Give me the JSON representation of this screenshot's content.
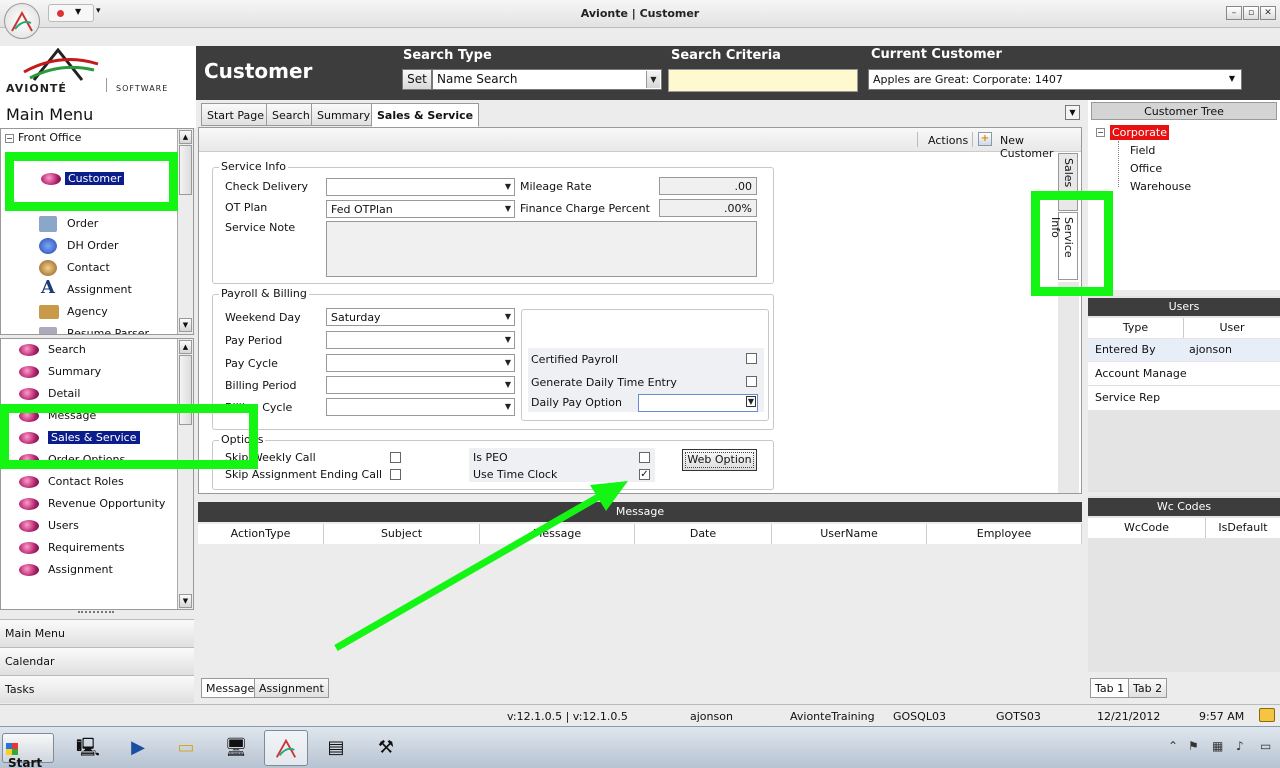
{
  "window": {
    "title": "Avionte | Customer"
  },
  "logo": {
    "brand": "AVIONTÉ",
    "software": "SOFTWARE"
  },
  "header": {
    "page_title": "Customer",
    "search_type_label": "Search Type",
    "set_label": "Set",
    "search_type_value": "Name Search",
    "search_criteria_label": "Search Criteria",
    "search_criteria_value": "",
    "current_customer_label": "Current Customer",
    "current_customer_value": "Apples are Great: Corporate: 1407"
  },
  "main_menu": {
    "title": "Main Menu",
    "tree_root": "Front Office",
    "tree_items": [
      {
        "label": "Customer",
        "icon": "customer-icon",
        "selected": true
      },
      {
        "label": "Order",
        "icon": "order-icon"
      },
      {
        "label": "DH Order",
        "icon": "dh-order-icon"
      },
      {
        "label": "Contact",
        "icon": "contact-icon"
      },
      {
        "label": "Assignment",
        "icon": "assignment-icon"
      },
      {
        "label": "Agency",
        "icon": "agency-icon"
      },
      {
        "label": "Resume Parser",
        "icon": "resume-parser-icon"
      }
    ],
    "sub_items": [
      "Search",
      "Summary",
      "Detail",
      "Message",
      "Sales & Service",
      "Order Options",
      "Contact Roles",
      "Revenue Opportunity",
      "Users",
      "Requirements",
      "Assignment"
    ],
    "selected_sub_item": "Sales & Service",
    "nav_buttons": [
      "Main Menu",
      "Calendar",
      "Tasks"
    ]
  },
  "tabs": [
    "Start Page",
    "Search",
    "Summary",
    "Sales & Service"
  ],
  "active_tab": "Sales & Service",
  "actions": {
    "actions_label": "Actions",
    "new_customer_label": "New Customer"
  },
  "side_tabs": [
    "Sales I",
    "Service Info"
  ],
  "service_info": {
    "title": "Service Info",
    "check_delivery_label": "Check Delivery",
    "check_delivery_value": "",
    "ot_plan_label": "OT Plan",
    "ot_plan_value": "Fed OTPlan",
    "service_note_label": "Service Note",
    "mileage_rate_label": "Mileage Rate",
    "mileage_rate_value": ".00",
    "finance_charge_label": "Finance Charge Percent",
    "finance_charge_value": ".00%"
  },
  "payroll_billing": {
    "title": "Payroll & Billing",
    "weekend_day_label": "Weekend Day",
    "weekend_day_value": "Saturday",
    "pay_period_label": "Pay Period",
    "pay_cycle_label": "Pay Cycle",
    "billing_period_label": "Billing Period",
    "billing_cycle_label": "Billing Cycle",
    "certified_payroll_label": "Certified Payroll",
    "certified_payroll_checked": false,
    "generate_daily_label": "Generate Daily Time Entry",
    "generate_daily_checked": false,
    "daily_pay_option_label": "Daily Pay Option"
  },
  "options": {
    "title": "Options",
    "skip_weekly_label": "Skip Weekly Call",
    "skip_weekly_checked": false,
    "skip_assignment_label": "Skip Assignment Ending Call",
    "skip_assignment_checked": false,
    "is_peo_label": "Is PEO",
    "is_peo_checked": false,
    "use_time_clock_label": "Use Time Clock",
    "use_time_clock_checked": true,
    "web_option_label": "Web Option"
  },
  "message_grid": {
    "title": "Message",
    "columns": [
      "ActionType",
      "Subject",
      "Message",
      "Date",
      "UserName",
      "Employee"
    ]
  },
  "bottom_tabs": [
    "Message",
    "Assignment"
  ],
  "customer_tree": {
    "title": "Customer Tree",
    "root": "Corporate",
    "children": [
      "Field",
      "Office",
      "Warehouse"
    ]
  },
  "users": {
    "title": "Users",
    "columns": [
      "Type",
      "User"
    ],
    "rows": [
      {
        "type": "Entered By",
        "user": "ajonson"
      },
      {
        "type": "Account Manage",
        "user": ""
      },
      {
        "type": "Service Rep",
        "user": ""
      }
    ]
  },
  "wc_codes": {
    "title": "Wc Codes",
    "columns": [
      "WcCode",
      "IsDefault"
    ]
  },
  "right_tabs": [
    "Tab 1",
    "Tab 2"
  ],
  "status": {
    "version": "v:12.1.0.5 | v:12.1.0.5",
    "user": "ajonson",
    "database": "AvionteTraining",
    "sql_server": "GOSQL03",
    "server": "GOTS03",
    "date": "12/21/2012",
    "time": "9:57 AM"
  },
  "taskbar": {
    "start_label": "Start"
  },
  "colors": {
    "header_bg": "#3d3d3d",
    "selection": "#0b1d8a",
    "highlight_annotation": "#14f514",
    "corporate_node": "#e81010",
    "search_criteria_bg": "#fff9cf"
  }
}
